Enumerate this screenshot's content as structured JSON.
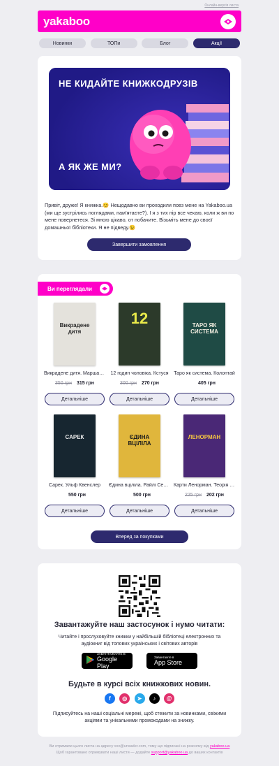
{
  "top": {
    "browser_link": "Онлайн-версія листа"
  },
  "header": {
    "logo": "yakaboo"
  },
  "nav": {
    "tabs": [
      "Новинки",
      "ТОПи",
      "Блог",
      "Акції"
    ],
    "active_index": 3
  },
  "promo": {
    "hero_title": "НЕ КИДАЙТЕ КНИЖКОДРУЗІВ",
    "hero_subtitle": "А ЯК ЖЕ МИ?",
    "text": "Привіт, друже! Я книжка.😊 Нещодавно ви проходили повз мене на Yakaboo.ua (ми ще зустрілись поглядами, пам'ятаєте?). І я з тих пір все чекаю, коли ж ви по мене повернетеся. Зі мною цікаво, от побачите. Візьміть мене до своєї домашньої бібліотеки. Я не підведу.😉",
    "button": "Завершити замовлення"
  },
  "viewed": {
    "tag": "Ви переглядали",
    "details_label": "Детальніше",
    "continue_button": "Вперед за покупками",
    "books": [
      {
        "title": "Викрадене дитя. Марша Форчук",
        "old_price": "350 грн",
        "price": "315 грн",
        "cover": {
          "bg": "#e4e2dc",
          "text": "Викрадене дитя",
          "color": "#2b2b2b"
        }
      },
      {
        "title": "12 годин чоловіка. Кстуся",
        "old_price": "300 грн",
        "price": "270 грн",
        "cover": {
          "bg": "#2c3a2a",
          "text": "12",
          "color": "#e9e94a"
        }
      },
      {
        "title": "Таро як система. Колонтай",
        "old_price": "",
        "price": "405 грн",
        "cover": {
          "bg": "#1f4b45",
          "text": "ТАРО ЯК СИСТЕМА",
          "color": "#f2ede0"
        }
      },
      {
        "title": "Сарек. Ульф Квенслер",
        "old_price": "",
        "price": "550 грн",
        "cover": {
          "bg": "#172630",
          "text": "САРЕК",
          "color": "#e9e9e9"
        }
      },
      {
        "title": "Єдина вціліла. Райлі Сейґер",
        "old_price": "",
        "price": "500 грн",
        "cover": {
          "bg": "#e0b63c",
          "text": "ЄДИНА ВЦІЛІЛА",
          "color": "#1d1d1d"
        }
      },
      {
        "title": "Карти Ленорман. Теорія і практика",
        "old_price": "225 грн",
        "price": "202 грн",
        "cover": {
          "bg": "#4a2876",
          "text": "ЛЕНОРМАН",
          "color": "#f5c542"
        }
      }
    ]
  },
  "app": {
    "title": "Завантажуйте наш застосунок і нумо читати:",
    "text": "Читайте і прослуховуйте книжки у найбільшій бібліотеці електронних та аудіокниг від топових українських і світових авторів",
    "google_small": "ЗАВАНТАЖУЙТЕ В",
    "google_big": "Google Play",
    "apple_small": "Завантажте в",
    "apple_big": "App Store",
    "news_title": "Будьте в курсі всіх книжкових новин.",
    "news_text": "Підписуйтесь на наші соціальні мережі, щоб стежити за новинками, свіжими акціями та унікальними промокодами на знижку.",
    "social": [
      {
        "icon": "facebook-icon",
        "glyph": "f",
        "color": "#1877f2"
      },
      {
        "icon": "instagram-icon",
        "glyph": "◎",
        "color": "#e1306c"
      },
      {
        "icon": "telegram-icon",
        "glyph": "➤",
        "color": "#29a9eb"
      },
      {
        "icon": "tiktok-icon",
        "glyph": "♪",
        "color": "#000000"
      },
      {
        "icon": "threads-icon",
        "glyph": "@",
        "color": "#e1306c"
      }
    ]
  },
  "footer": {
    "text1": "Ви отримали цього листа на адресу xxx@unsader.com, тому що підписані на розсилку від",
    "link1": "yakaboo.ua",
    "text2": "Щоб гарантовано отримувати наші листи — додайте",
    "link2": "support@yakaboo.ua",
    "text3": "до ваших контактів"
  },
  "colors": {
    "brand": "#ff00c8",
    "dark": "#2d2a6e"
  }
}
